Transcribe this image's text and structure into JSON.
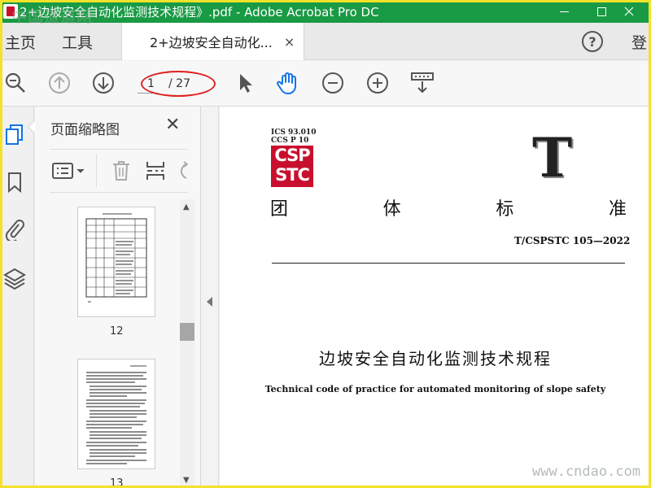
{
  "window": {
    "title": "2+边坡安全自动化监测技术规程》.pdf - Adobe Acrobat Pro DC",
    "watermark_top_left": "中国道道网",
    "watermark_bottom_right": "www.cndao.com"
  },
  "tabs": {
    "home": "主页",
    "tools": "工具",
    "document_tab": "2+边坡安全自动化...",
    "close_glyph": "×",
    "help_glyph": "?",
    "signin": "登"
  },
  "toolbar": {
    "current_page": "1",
    "page_total": "/ 27",
    "icons": [
      "zoom-search-icon",
      "previous-page-icon",
      "next-page-icon",
      "select-cursor-icon",
      "hand-tool-icon",
      "zoom-out-icon",
      "zoom-in-icon",
      "scroll-mode-icon"
    ]
  },
  "sidebar_rail": {
    "icons": [
      "page-thumbnails-icon",
      "bookmark-icon",
      "attachment-icon",
      "layers-icon"
    ]
  },
  "thumbnails_panel": {
    "title": "页面缩略图",
    "close_glyph": "✕",
    "tools": [
      "options-menu-icon",
      "delete-page-icon",
      "insert-page-icon",
      "rotate-page-icon"
    ],
    "pages": [
      {
        "label": "12"
      },
      {
        "label": "13"
      }
    ]
  },
  "document": {
    "ics": "ICS 93.010",
    "ccs": "CCS P 10",
    "logo_line1": "CSP",
    "logo_line2": "STC",
    "big_letter": "T",
    "standard_type_chars": [
      "团",
      "体",
      "标",
      "准"
    ],
    "standard_number": "T/CSPSTC 105—2022",
    "title_cn": "边坡安全自动化监测技术规程",
    "title_en": "Technical code of practice for automated monitoring of slope safety"
  },
  "colors": {
    "titlebar": "#199a44",
    "frame": "#f2e32a",
    "logo_red": "#c8102e",
    "annotation_red": "#e02020",
    "accent_blue": "#1473e6"
  }
}
